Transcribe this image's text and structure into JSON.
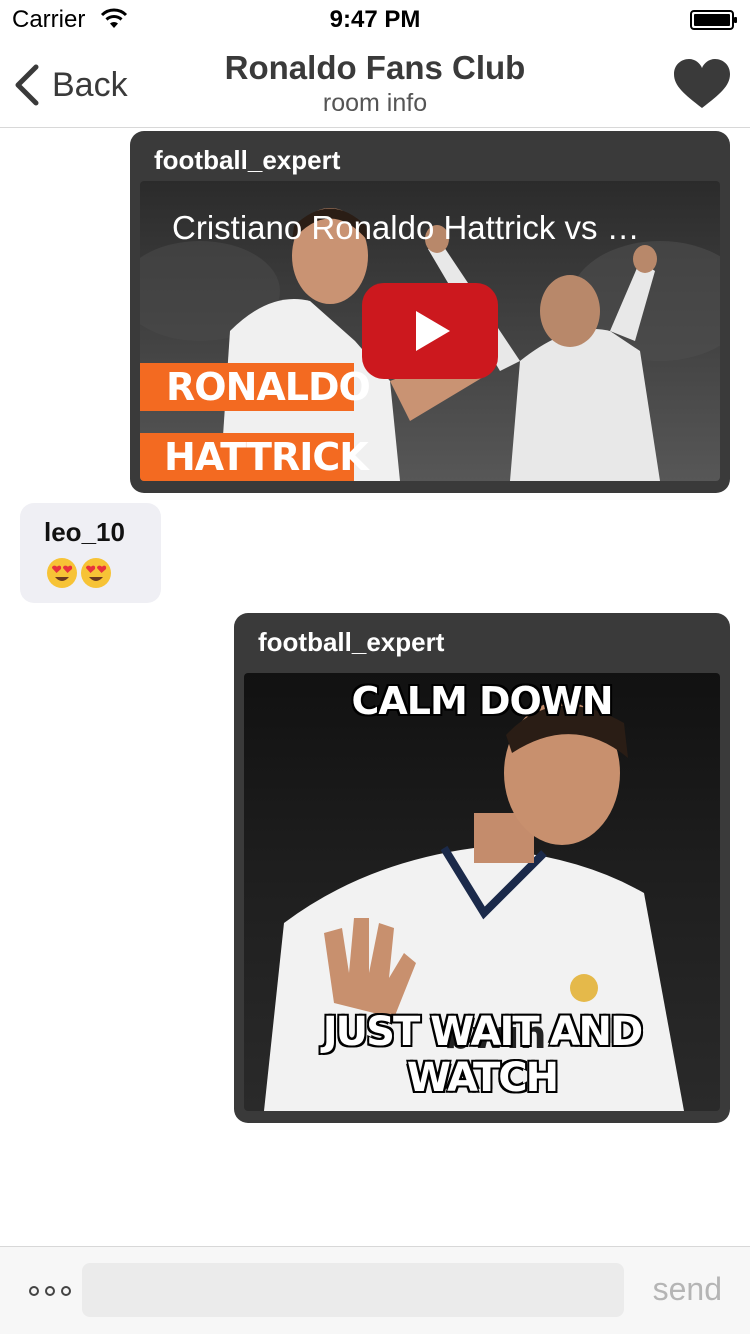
{
  "status_bar": {
    "carrier": "Carrier",
    "time": "9:47 PM",
    "wifi_icon": "wifi-icon",
    "battery_icon": "battery-full-icon"
  },
  "nav": {
    "back_label": "Back",
    "back_icon": "chevron-left-icon",
    "title": "Ronaldo Fans Club",
    "subtitle": "room info",
    "favorite_icon": "heart-icon"
  },
  "messages": [
    {
      "sender": "football_expert",
      "type": "video",
      "video_title": "Cristiano Ronaldo Hattrick vs …",
      "thumbnail_banners": [
        "RONALDO",
        "HATTRICK"
      ],
      "play_icon": "youtube-play-icon"
    },
    {
      "sender": "leo_10",
      "type": "text",
      "text": "😍😍",
      "emojis": [
        "heart-eyes-emoji",
        "heart-eyes-emoji"
      ]
    },
    {
      "sender": "football_expert",
      "type": "image",
      "meme_top": "CALM DOWN",
      "meme_bottom": "JUST WAIT AND WATCH"
    }
  ],
  "composer": {
    "more_icon": "more-dots-icon",
    "input_value": "",
    "input_placeholder": "",
    "send_label": "send"
  },
  "colors": {
    "bubble_dark": "#3a3a3a",
    "bubble_light": "#efeff4",
    "banner_orange": "#f36a21",
    "play_red": "#e52d27",
    "send_disabled": "#b5b5b5"
  }
}
